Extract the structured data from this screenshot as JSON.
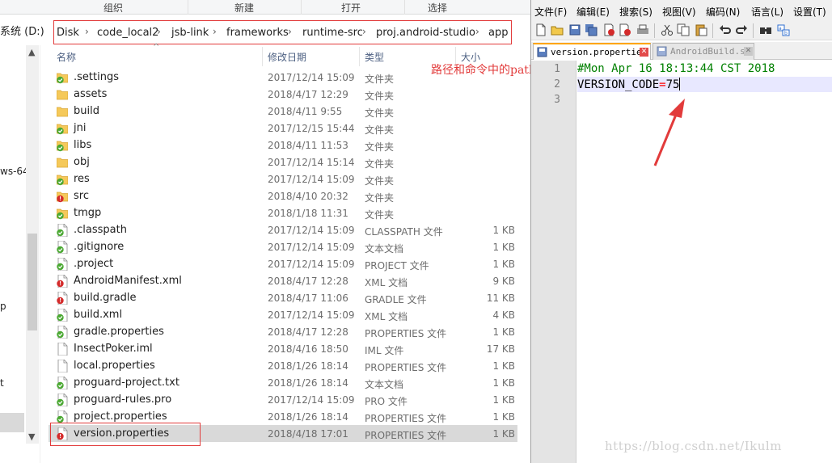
{
  "explorer": {
    "ribbon_groups": [
      "组织",
      "新建",
      "打开",
      "选择"
    ],
    "nav_drive": "系统 (D:)",
    "nav_fragments": [
      "ws-64",
      "p",
      "t"
    ],
    "breadcrumb": [
      "Disk",
      "code_local2",
      "jsb-link",
      "frameworks",
      "runtime-src",
      "proj.android-studio",
      "app"
    ],
    "columns": {
      "name": "名称",
      "date": "修改日期",
      "type": "类型",
      "size": "大小"
    },
    "files": [
      {
        "name": ".settings",
        "date": "2017/12/14 15:09",
        "type": "文件夹",
        "size": "",
        "icon": "folder-check-icon"
      },
      {
        "name": "assets",
        "date": "2018/4/17 12:29",
        "type": "文件夹",
        "size": "",
        "icon": "folder-icon"
      },
      {
        "name": "build",
        "date": "2018/4/11 9:55",
        "type": "文件夹",
        "size": "",
        "icon": "folder-icon"
      },
      {
        "name": "jni",
        "date": "2017/12/15 15:44",
        "type": "文件夹",
        "size": "",
        "icon": "folder-check-icon"
      },
      {
        "name": "libs",
        "date": "2018/4/11 11:53",
        "type": "文件夹",
        "size": "",
        "icon": "folder-check-icon"
      },
      {
        "name": "obj",
        "date": "2017/12/14 15:14",
        "type": "文件夹",
        "size": "",
        "icon": "folder-icon"
      },
      {
        "name": "res",
        "date": "2017/12/14 15:09",
        "type": "文件夹",
        "size": "",
        "icon": "folder-check-icon"
      },
      {
        "name": "src",
        "date": "2018/4/10 20:32",
        "type": "文件夹",
        "size": "",
        "icon": "folder-modified-icon"
      },
      {
        "name": "tmgp",
        "date": "2018/1/18 11:31",
        "type": "文件夹",
        "size": "",
        "icon": "folder-check-icon"
      },
      {
        "name": ".classpath",
        "date": "2017/12/14 15:09",
        "type": "CLASSPATH 文件",
        "size": "1 KB",
        "icon": "file-check-icon"
      },
      {
        "name": ".gitignore",
        "date": "2017/12/14 15:09",
        "type": "文本文档",
        "size": "1 KB",
        "icon": "file-check-icon"
      },
      {
        "name": ".project",
        "date": "2017/12/14 15:09",
        "type": "PROJECT 文件",
        "size": "1 KB",
        "icon": "file-check-icon"
      },
      {
        "name": "AndroidManifest.xml",
        "date": "2018/4/17 12:28",
        "type": "XML 文档",
        "size": "9 KB",
        "icon": "file-modified-icon"
      },
      {
        "name": "build.gradle",
        "date": "2018/4/17 11:06",
        "type": "GRADLE 文件",
        "size": "11 KB",
        "icon": "file-modified-icon"
      },
      {
        "name": "build.xml",
        "date": "2017/12/14 15:09",
        "type": "XML 文档",
        "size": "4 KB",
        "icon": "file-check-icon"
      },
      {
        "name": "gradle.properties",
        "date": "2018/4/17 12:28",
        "type": "PROPERTIES 文件",
        "size": "1 KB",
        "icon": "file-check-icon"
      },
      {
        "name": "InsectPoker.iml",
        "date": "2018/4/16 18:50",
        "type": "IML 文件",
        "size": "17 KB",
        "icon": "file-icon"
      },
      {
        "name": "local.properties",
        "date": "2018/1/26 18:14",
        "type": "PROPERTIES 文件",
        "size": "1 KB",
        "icon": "file-icon"
      },
      {
        "name": "proguard-project.txt",
        "date": "2018/1/26 18:14",
        "type": "文本文档",
        "size": "1 KB",
        "icon": "file-check-icon"
      },
      {
        "name": "proguard-rules.pro",
        "date": "2017/12/14 15:09",
        "type": "PRO 文件",
        "size": "1 KB",
        "icon": "file-check-icon"
      },
      {
        "name": "project.properties",
        "date": "2018/1/26 18:14",
        "type": "PROPERTIES 文件",
        "size": "1 KB",
        "icon": "file-check-icon"
      },
      {
        "name": "version.properties",
        "date": "2018/4/18 17:01",
        "type": "PROPERTIES 文件",
        "size": "1 KB",
        "icon": "file-modified-icon",
        "selected": true
      }
    ]
  },
  "annotation": "路径和命令中的path对应",
  "editor": {
    "menus": [
      "文件(F)",
      "编辑(E)",
      "搜索(S)",
      "视图(V)",
      "编码(N)",
      "语言(L)",
      "设置(T)"
    ],
    "tabs": [
      {
        "name": "version.properties",
        "active": true
      },
      {
        "name": "AndroidBuild.sh",
        "active": false
      }
    ],
    "line_numbers": [
      "1",
      "2",
      "3"
    ],
    "lines": {
      "comment": "#Mon Apr 16 18:13:44 CST 2018",
      "key": "VERSION_CODE",
      "eq": "=",
      "value": "75"
    }
  },
  "watermark": "https://blog.csdn.net/Ikulm",
  "colors": {
    "annotation_red": "#e23b3b",
    "comment_green": "#008000",
    "svn_green": "#4aa832",
    "svn_red": "#d42b2b"
  }
}
